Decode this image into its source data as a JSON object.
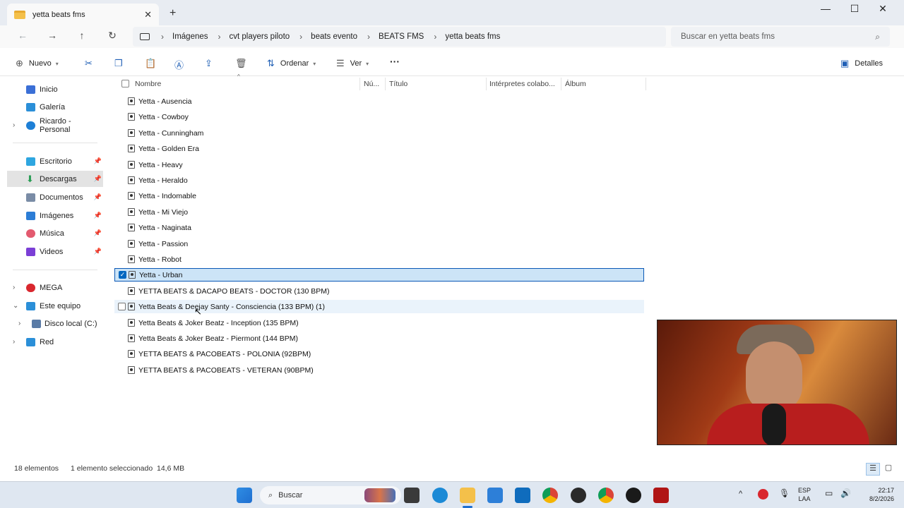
{
  "window": {
    "tab_title": "yetta beats fms"
  },
  "breadcrumb": [
    "Imágenes",
    "cvt players piloto",
    "beats evento",
    "BEATS FMS",
    "yetta beats fms"
  ],
  "search": {
    "placeholder": "Buscar en yetta beats fms"
  },
  "toolbar": {
    "new_label": "Nuevo",
    "sort_label": "Ordenar",
    "view_label": "Ver",
    "more_label": "···",
    "details_label": "Detalles"
  },
  "sidebar": {
    "items": [
      {
        "label": "Inicio",
        "color": "#3b6fd6"
      },
      {
        "label": "Galería",
        "color": "#2b8fd8"
      },
      {
        "label": "Ricardo - Personal",
        "color": "#1e7fd6"
      },
      {
        "label": "Escritorio",
        "color": "#2ea6e0"
      },
      {
        "label": "Descargas",
        "color": "#2a9d55"
      },
      {
        "label": "Documentos",
        "color": "#7a8ca6"
      },
      {
        "label": "Imágenes",
        "color": "#2c7dd6"
      },
      {
        "label": "Música",
        "color": "#e35a6f"
      },
      {
        "label": "Videos",
        "color": "#7b3fd6"
      },
      {
        "label": "MEGA",
        "color": "#d9272e"
      },
      {
        "label": "Este equipo",
        "color": "#2b8fd8"
      },
      {
        "label": "Disco local (C:)",
        "color": "#5a7ba6"
      },
      {
        "label": "Red",
        "color": "#2b8fd8"
      }
    ]
  },
  "columns": [
    "Nombre",
    "Nú...",
    "Título",
    "Intérpretes colabo...",
    "Álbum"
  ],
  "files": [
    "Yetta - Ausencia",
    "Yetta - Cowboy",
    "Yetta - Cunningham",
    "Yetta - Golden Era",
    "Yetta - Heavy",
    "Yetta - Heraldo",
    "Yetta - Indomable",
    "Yetta - Mi Viejo",
    "Yetta - Naginata",
    "Yetta - Passion",
    "Yetta - Robot",
    "Yetta - Urban",
    "YETTA BEATS & DACAPO BEATS - DOCTOR (130 BPM)",
    "Yetta Beats & Deejay Santy - Consciencia (133 BPM) (1)",
    "Yetta Beats & Joker Beatz - Inception (135 BPM)",
    "Yetta Beats & Joker Beatz - Piermont (144 BPM)",
    "YETTA BEATS & PACOBEATS - POLONIA (92BPM)",
    "YETTA BEATS & PACOBEATS - VETERAN (90BPM)"
  ],
  "status": {
    "count": "18 elementos",
    "selection": "1 elemento seleccionado",
    "size": "14,6 MB"
  },
  "taskbar": {
    "search_label": "Buscar",
    "lang_top": "ESP",
    "lang_bottom": "LAA",
    "time": "22:17",
    "date": "8/2/2026"
  }
}
